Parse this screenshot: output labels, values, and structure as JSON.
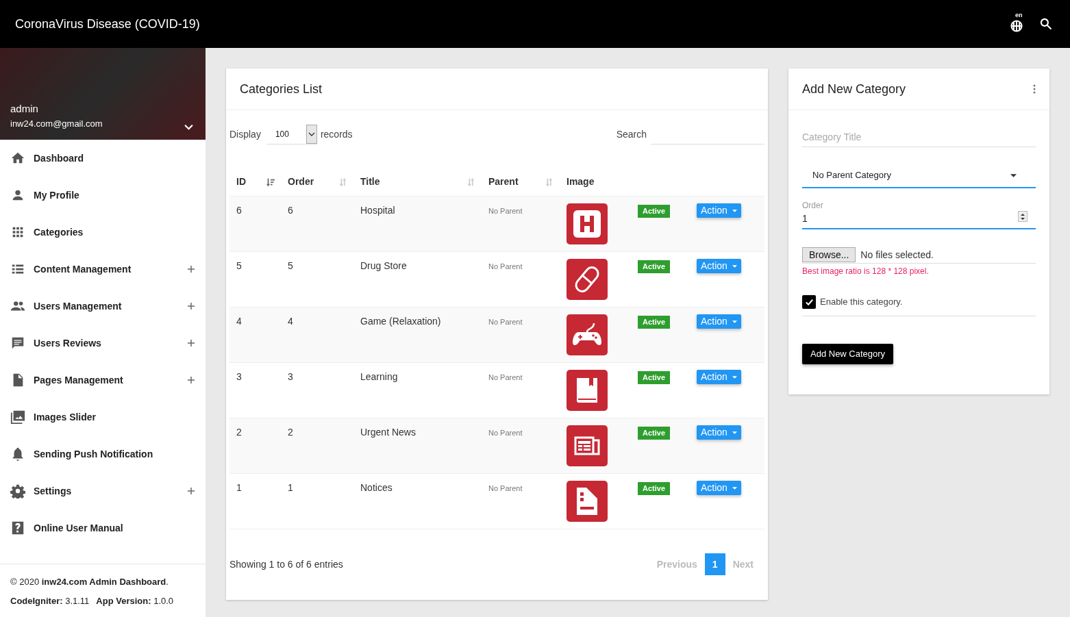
{
  "header": {
    "title": "CoronaVirus Disease (COVID-19)",
    "language": "en"
  },
  "sidebar": {
    "user": {
      "name": "admin",
      "email": "inw24.com@gmail.com"
    },
    "items": [
      {
        "kind": "home",
        "label": "Dashboard",
        "expandable": false
      },
      {
        "kind": "person",
        "label": "My Profile",
        "expandable": false
      },
      {
        "kind": "grid",
        "label": "Categories",
        "expandable": false
      },
      {
        "kind": "list",
        "label": "Content Management",
        "expandable": true
      },
      {
        "kind": "people",
        "label": "Users Management",
        "expandable": true
      },
      {
        "kind": "chat",
        "label": "Users Reviews",
        "expandable": true
      },
      {
        "kind": "page",
        "label": "Pages Management",
        "expandable": true
      },
      {
        "kind": "image",
        "label": "Images Slider",
        "expandable": false
      },
      {
        "kind": "bell",
        "label": "Sending Push Notification",
        "expandable": false
      },
      {
        "kind": "gear",
        "label": "Settings",
        "expandable": true
      },
      {
        "kind": "help",
        "label": "Online User Manual",
        "expandable": false
      }
    ],
    "footer": {
      "copyright": "© 2020 **inw24.com Admin Dashboard**.",
      "versions": [
        {
          "label": "CodeIgniter:",
          "value": "3.1.11"
        },
        {
          "label": "App Version:",
          "value": "1.0.0"
        }
      ]
    }
  },
  "list_card": {
    "title": "Categories List",
    "display_label": "Display",
    "display_value": "100",
    "records_label": "records",
    "search_label": "Search",
    "columns": [
      {
        "label": "ID",
        "kind": "sorted"
      },
      {
        "label": "Order",
        "kind": "sortable"
      },
      {
        "label": "Title",
        "kind": "sortable"
      },
      {
        "label": "Parent",
        "kind": "sortable"
      },
      {
        "label": "Image",
        "kind": "plain"
      }
    ],
    "rows": [
      {
        "id": "6",
        "order": "6",
        "title": "Hospital",
        "parent": "No Parent",
        "kind": "hospital",
        "status": "Active",
        "action": "Action"
      },
      {
        "id": "5",
        "order": "5",
        "title": "Drug Store",
        "parent": "No Parent",
        "kind": "pill",
        "status": "Active",
        "action": "Action"
      },
      {
        "id": "4",
        "order": "4",
        "title": "Game (Relaxation)",
        "parent": "No Parent",
        "kind": "gamepad",
        "status": "Active",
        "action": "Action"
      },
      {
        "id": "3",
        "order": "3",
        "title": "Learning",
        "parent": "No Parent",
        "kind": "book",
        "status": "Active",
        "action": "Action"
      },
      {
        "id": "2",
        "order": "2",
        "title": "Urgent News",
        "parent": "No Parent",
        "kind": "newspaper",
        "status": "Active",
        "action": "Action"
      },
      {
        "id": "1",
        "order": "1",
        "title": "Notices",
        "parent": "No Parent",
        "kind": "document",
        "status": "Active",
        "action": "Action"
      }
    ],
    "info": "Showing 1 to 6 of 6 entries",
    "pagination": [
      {
        "label": "Previous",
        "selected": false,
        "disabled": true
      },
      {
        "label": "1",
        "selected": true,
        "disabled": false
      },
      {
        "label": "Next",
        "selected": false,
        "disabled": true
      }
    ]
  },
  "form_card": {
    "title": "Add New Category",
    "title_placeholder": "Category Title",
    "parent_value": "No Parent Category",
    "order_label": "Order",
    "order_value": "1",
    "browse_label": "Browse...",
    "file_status": "No files selected.",
    "hint": "Best image ratio is 128 * 128 pixel.",
    "enable_label": "Enable this category.",
    "enable_checked": true,
    "submit": "Add New Category"
  }
}
